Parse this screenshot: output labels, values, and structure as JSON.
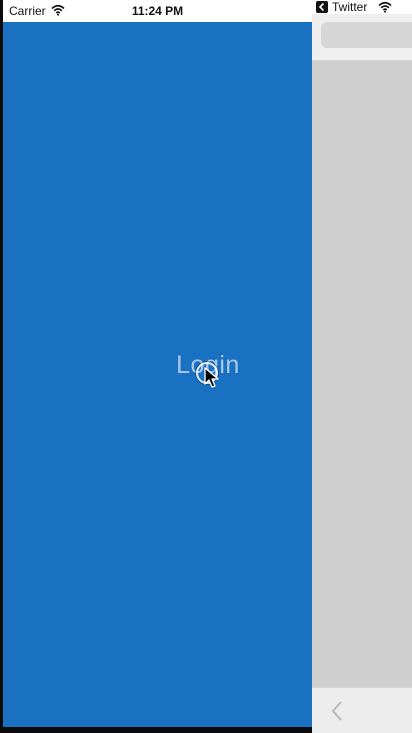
{
  "status_bar": {
    "carrier": "Carrier",
    "time": "11:24 PM"
  },
  "main": {
    "login_label": "Login",
    "background_color": "#1b71c1"
  },
  "side_panel": {
    "back_app_label": "Twitter",
    "background_color": "#cfcfcf"
  },
  "icons": {
    "wifi": "wifi-icon",
    "cursor": "cursor-icon",
    "back_app": "chevron-left-icon",
    "nav_back": "back-chevron-icon"
  }
}
